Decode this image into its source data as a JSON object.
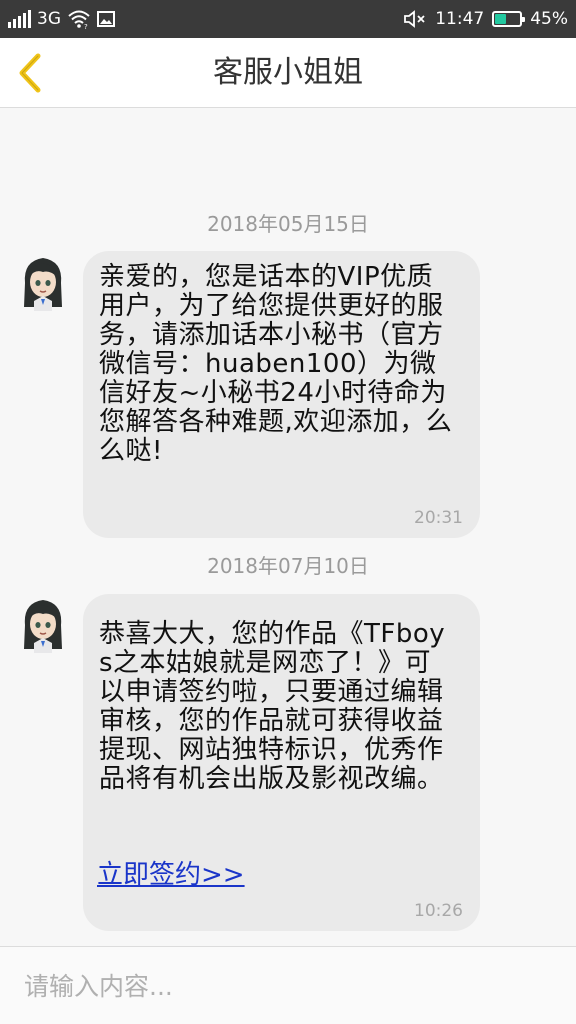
{
  "status_bar": {
    "network": "3G",
    "time": "11:47",
    "battery": "45%",
    "battery_level": 0.45,
    "icons": [
      "signal-icon",
      "wifi-icon",
      "image-notification-icon",
      "mute-icon",
      "battery-icon"
    ]
  },
  "header": {
    "title": "客服小姐姐",
    "back_icon": "chevron-left-icon",
    "accent_color": "#f0c419"
  },
  "messages": [
    {
      "date": "2018年05月15日",
      "text": "亲爱的，您是话本的VIP优质用户，为了给您提供更好的服务，请添加话本小秘书（官方微信号：huaben100）为微信好友~小秘书24小时待命为您解答各种难题,欢迎添加，么么哒!",
      "time": "20:31"
    },
    {
      "date": "2018年07月10日",
      "text": " 恭喜大大，您的作品《TFboys之本姑娘就是网恋了！》可以申请签约啦，只要通过编辑审核，您的作品就可获得收益提现、网站独特标识，优秀作品将有机会出版及影视改编。",
      "link": "立即签约>>",
      "time": "10:26"
    }
  ],
  "input": {
    "placeholder": "请输入内容..."
  }
}
